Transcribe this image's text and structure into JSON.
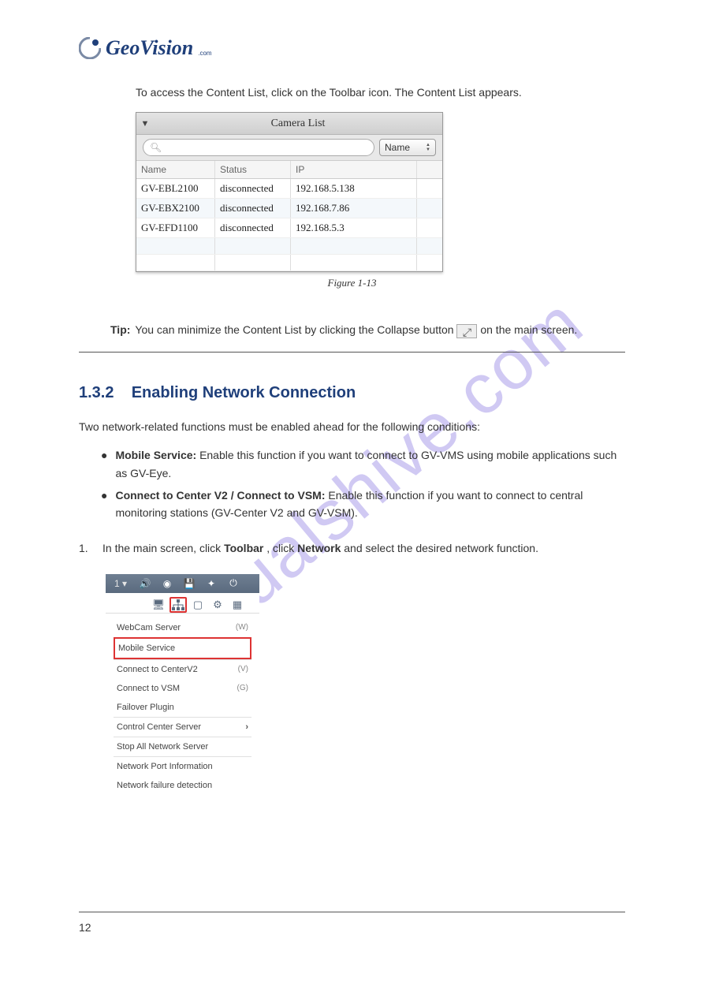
{
  "brand": {
    "name": "GeoVision",
    "suffix": ".com"
  },
  "intro_text": "To access the Content List, click on the Toolbar icon. The Content List appears.",
  "camera_list": {
    "title": "Camera List",
    "search_placeholder": "",
    "name_button": "Name",
    "columns": {
      "name": "Name",
      "status": "Status",
      "ip": "IP"
    },
    "rows": [
      {
        "name": "GV-EBL2100",
        "status": "disconnected",
        "ip": "192.168.5.138"
      },
      {
        "name": "GV-EBX2100",
        "status": "disconnected",
        "ip": "192.168.7.86"
      },
      {
        "name": "GV-EFD1100",
        "status": "disconnected",
        "ip": "192.168.5.3"
      }
    ],
    "figure_caption": "Figure 1-13"
  },
  "tip": {
    "label": "Tip:",
    "text_before": "You can minimize the Content List by clicking the Collapse button ",
    "icon_name": "collapse-icon",
    "text_after": " on the main screen."
  },
  "section": {
    "number": "1.3.2",
    "title": "Enabling Network Connection"
  },
  "intro2": "Two network-related functions must be enabled ahead for the following conditions:",
  "bullets": [
    {
      "label": "Mobile Service:",
      "text": "Enable this function if you want to connect to GV-VMS using mobile applications such as GV-Eye."
    },
    {
      "label": "Connect to Center V2 / Connect to VSM:",
      "text": "Enable this function if you want to connect to central monitoring stations (GV-Center V2 and GV-VSM)."
    }
  ],
  "steps": [
    {
      "num": "1.",
      "text_before": "In the main screen, click ",
      "bold1": "Toolbar",
      "mid": ", click ",
      "bold2": "Network",
      "mid2": " and select the desired network function."
    }
  ],
  "menu_shot": {
    "topbar_num": "1 ▾",
    "items_group1": [
      {
        "label": "WebCam Server",
        "hotkey": "(W)"
      },
      {
        "label": "Mobile Service",
        "hotkey": "",
        "highlight": true
      }
    ],
    "items_group2": [
      {
        "label": "Connect to CenterV2",
        "hotkey": "(V)"
      },
      {
        "label": "Connect to VSM",
        "hotkey": "(G)"
      },
      {
        "label": "Failover Plugin",
        "hotkey": ""
      }
    ],
    "items_group3": [
      {
        "label": "Control Center Server",
        "hotkey": "",
        "submenu": true
      }
    ],
    "items_group4": [
      {
        "label": "Stop All Network Server",
        "hotkey": ""
      }
    ],
    "items_group5": [
      {
        "label": "Network Port Information",
        "hotkey": ""
      },
      {
        "label": "Network failure detection",
        "hotkey": ""
      }
    ]
  },
  "page_number": "12"
}
